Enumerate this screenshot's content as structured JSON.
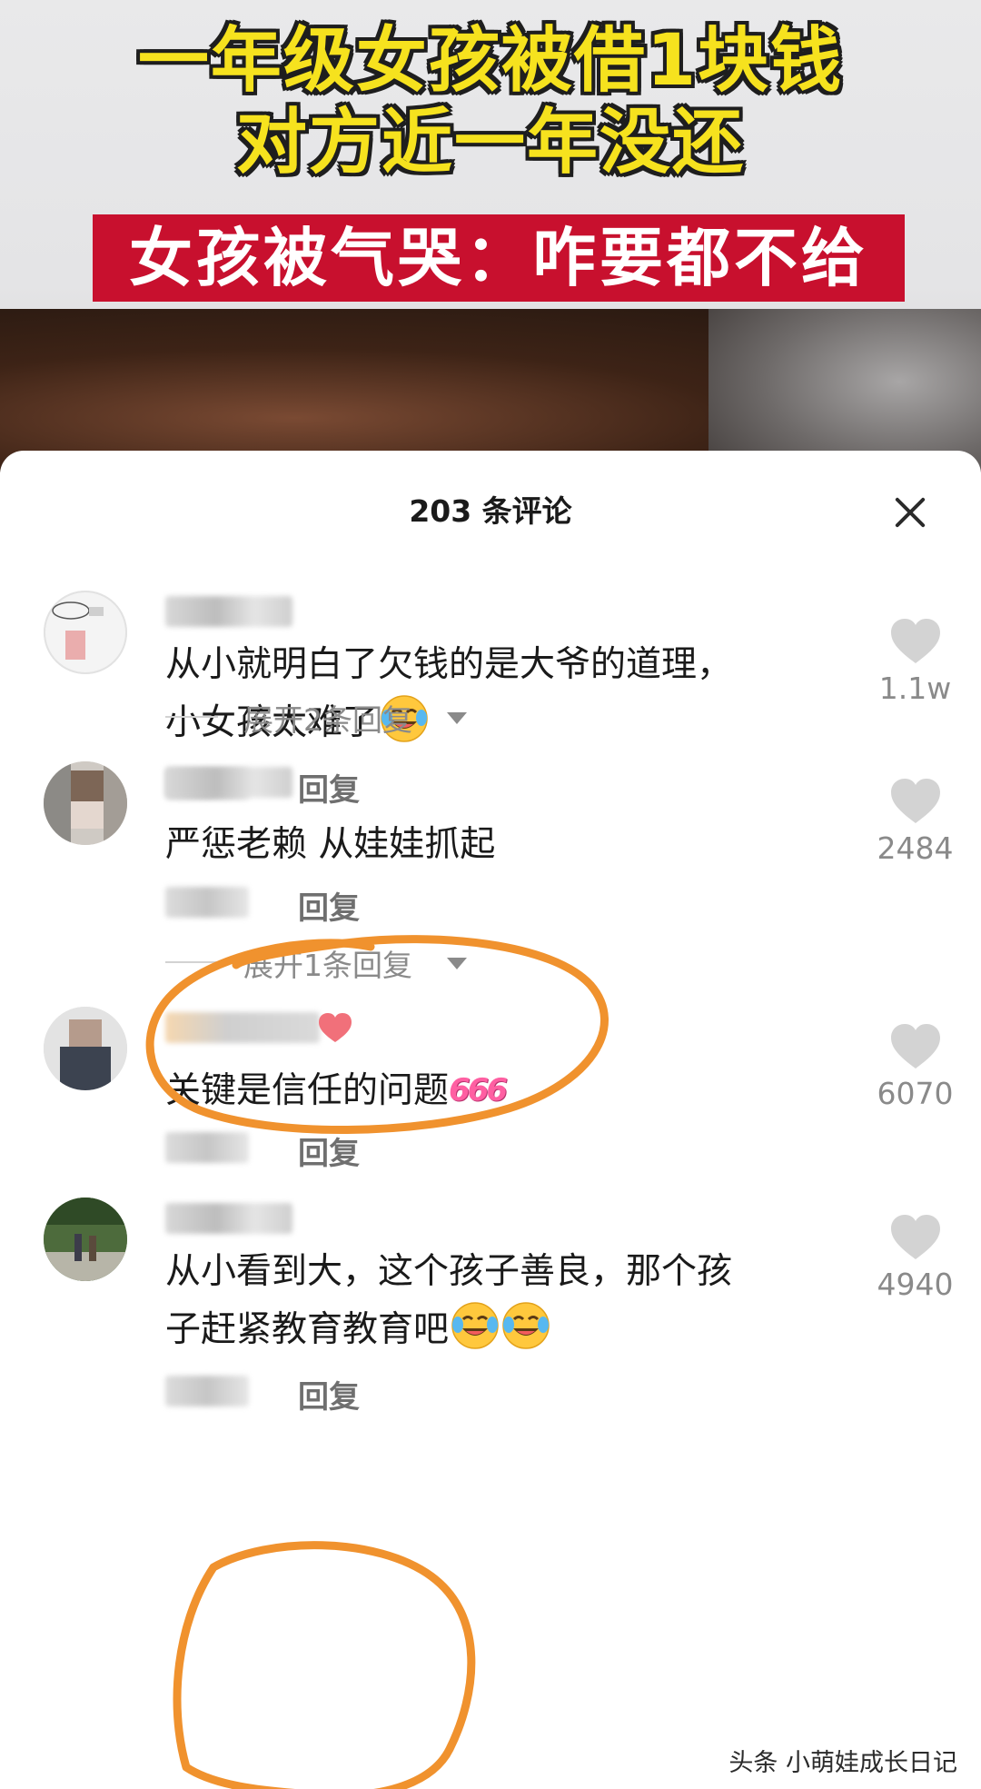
{
  "video": {
    "headline_line1": "一年级女孩被借1块钱",
    "headline_line2": "对方近一年没还",
    "sub_banner": "女孩被气哭：咋要都不给"
  },
  "panel": {
    "title": "203 条评论"
  },
  "comments": [
    {
      "text_line1": "从小就明白了欠钱的是大爷的道理，",
      "text_line2": "小女孩太难了",
      "likes": "1.1w",
      "reply_label": "回复",
      "expand_label": "展开2条回复",
      "emoji": "laughing-crying-emoji"
    },
    {
      "text_line1": "严惩老赖 从娃娃抓起",
      "likes": "2484",
      "reply_label": "回复",
      "expand_label": "展开1条回复"
    },
    {
      "text_line1": "关键是信任的问题",
      "tag": "666",
      "likes": "6070",
      "reply_label": "回复"
    },
    {
      "text_line1": "从小看到大，这个孩子善良，那个孩",
      "text_line2": "子赶紧教育教育吧",
      "likes": "4940",
      "reply_label": "回复",
      "emoji": "laughing-crying-emoji"
    }
  ],
  "watermark": "头条 小萌娃成长日记",
  "colors": {
    "headline_yellow": "#f6e21e",
    "banner_red": "#c8102e",
    "annotation_orange": "#f0922e",
    "meta_gray": "#8a8a8a"
  }
}
